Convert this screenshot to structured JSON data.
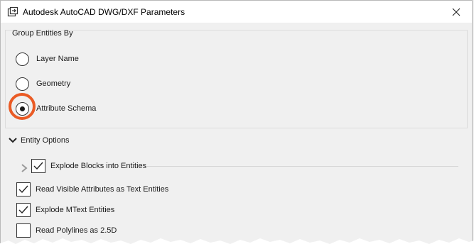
{
  "window": {
    "title": "Autodesk AutoCAD DWG/DXF Parameters",
    "icons": {
      "app": "app-window-icon",
      "close": "close-icon"
    }
  },
  "group_entities": {
    "title": "Group Entities By",
    "options": [
      {
        "label": "Layer Name",
        "selected": false
      },
      {
        "label": "Geometry",
        "selected": false
      },
      {
        "label": "Attribute Schema",
        "selected": true
      }
    ],
    "highlight_color": "#ea5b25"
  },
  "entity_options": {
    "title": "Entity Options",
    "expanded": true,
    "items": [
      {
        "label": "Explode Blocks into Entities",
        "checked": true,
        "expandable": true
      },
      {
        "label": "Read Visible Attributes as Text Entities",
        "checked": true
      },
      {
        "label": "Explode MText Entities",
        "checked": true
      },
      {
        "label": "Read Polylines as 2.5D",
        "checked": false
      }
    ]
  }
}
